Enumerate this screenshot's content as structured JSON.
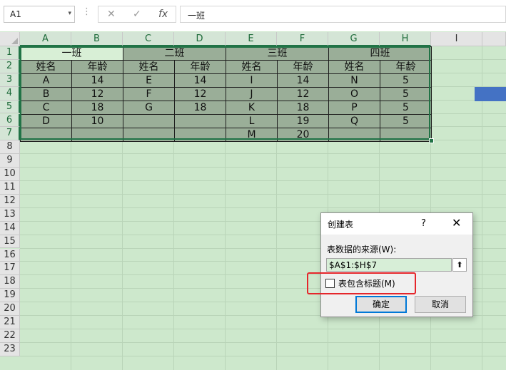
{
  "formula_bar": {
    "name_box": "A1",
    "name_box_caret": "▾",
    "separator": "⋮",
    "cancel_glyph": "✕",
    "enter_glyph": "✓",
    "function_glyph": "fx",
    "content": "一班"
  },
  "columns": [
    "A",
    "B",
    "C",
    "D",
    "E",
    "F",
    "G",
    "H",
    "I"
  ],
  "rows": [
    "1",
    "2",
    "3",
    "4",
    "5",
    "6",
    "7",
    "8",
    "9",
    "10",
    "11",
    "12",
    "13",
    "14",
    "15",
    "16",
    "17",
    "18",
    "19",
    "20",
    "21",
    "22",
    "23"
  ],
  "table": {
    "groups": [
      "一班",
      "二班",
      "三班",
      "四班"
    ],
    "headers": [
      "姓名",
      "年龄",
      "姓名",
      "年龄",
      "姓名",
      "年龄",
      "姓名",
      "年龄"
    ],
    "data": [
      [
        "A",
        "14",
        "E",
        "14",
        "I",
        "14",
        "N",
        "5"
      ],
      [
        "B",
        "12",
        "F",
        "12",
        "J",
        "12",
        "O",
        "5"
      ],
      [
        "C",
        "18",
        "G",
        "18",
        "K",
        "18",
        "P",
        "5"
      ],
      [
        "D",
        "10",
        "",
        "",
        "L",
        "19",
        "Q",
        "5"
      ],
      [
        "",
        "",
        "",
        "",
        "M",
        "20",
        "",
        ""
      ]
    ]
  },
  "colors": {
    "selection_accent": "#217346",
    "table_fill": "#9aae98",
    "sheet_background": "#cde8cc",
    "shape_fill": "#4472c4",
    "highlight_border": "#e5262b"
  },
  "dialog": {
    "title": "创建表",
    "help": "?",
    "close": "✕",
    "source_label": "表数据的来源(W):",
    "range_value": "$A$1:$H$7",
    "collapse_icon": "⬆",
    "header_checkbox_label": "表包含标题(M)",
    "header_checkbox_checked": false,
    "ok_label": "确定",
    "cancel_label": "取消"
  }
}
